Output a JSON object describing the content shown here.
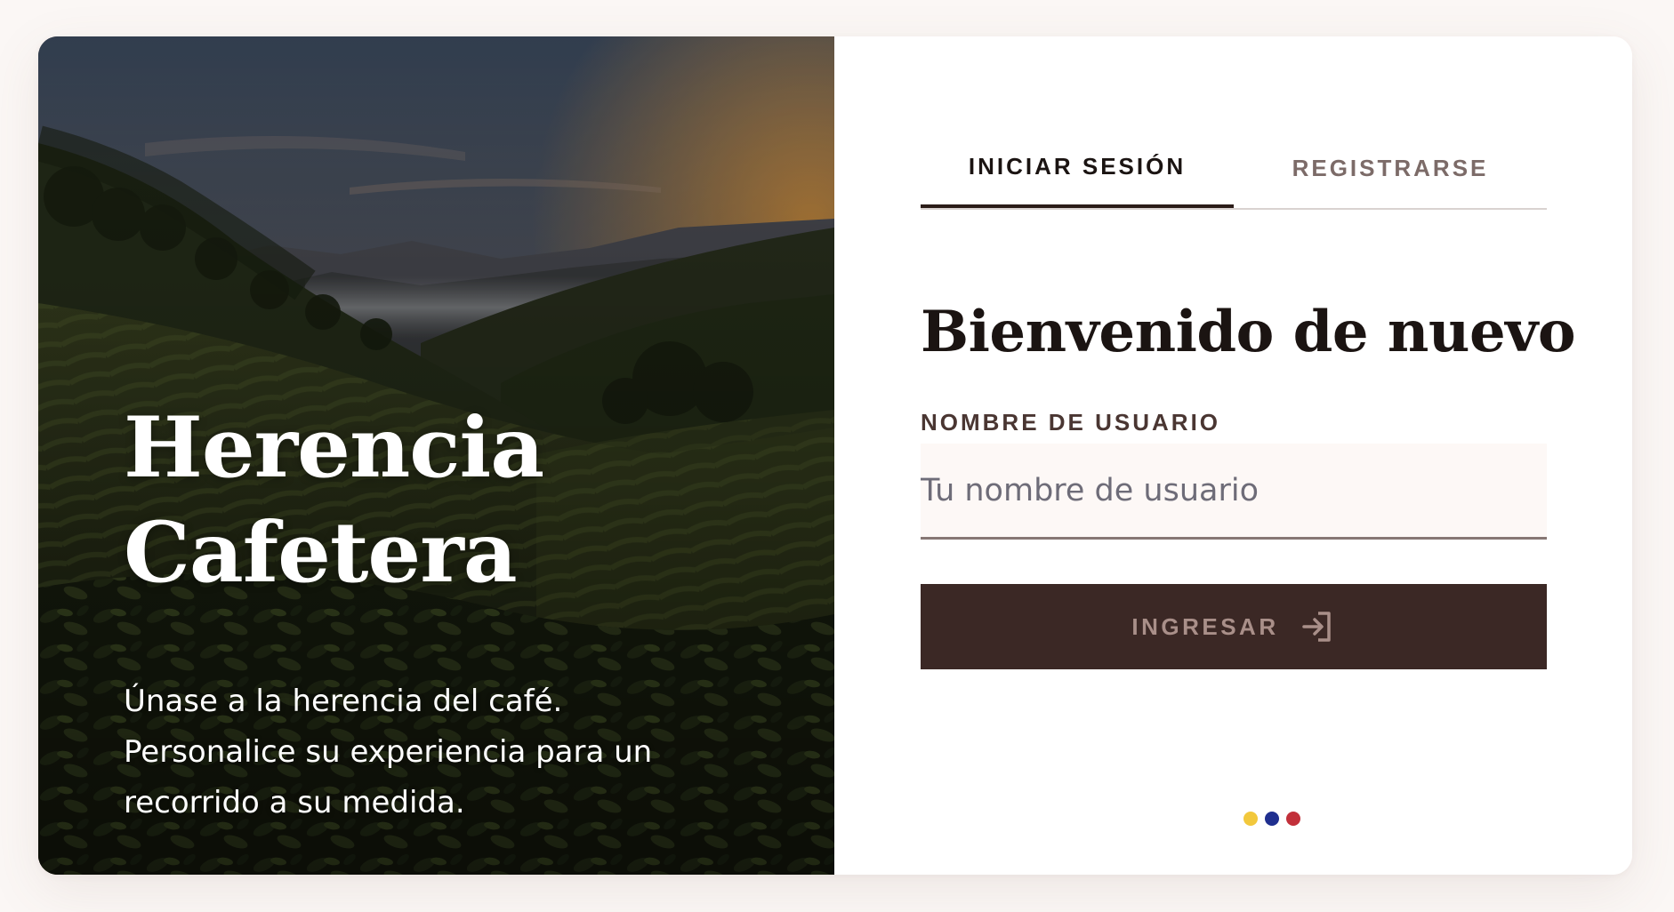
{
  "hero": {
    "title_line1": "Herencia",
    "title_line2": "Cafetera",
    "description": "Únase a la herencia del café. Personalice su experiencia para un recorrido a su medida."
  },
  "tabs": [
    {
      "label": "INICIAR SESIÓN",
      "active": true
    },
    {
      "label": "REGISTRARSE",
      "active": false
    }
  ],
  "form": {
    "heading": "Bienvenido de nuevo",
    "username_label": "NOMBRE DE USUARIO",
    "username_placeholder": "Tu nombre de usuario",
    "username_value": "",
    "submit_label": "INGRESAR",
    "submit_icon": "login-arrow-icon"
  },
  "colors": {
    "brand_dark": "#3b2825",
    "page_bg": "#fbf7f5",
    "dot_yellow": "#f2c83c",
    "dot_blue": "#1f2f8f",
    "dot_red": "#c2303a"
  }
}
